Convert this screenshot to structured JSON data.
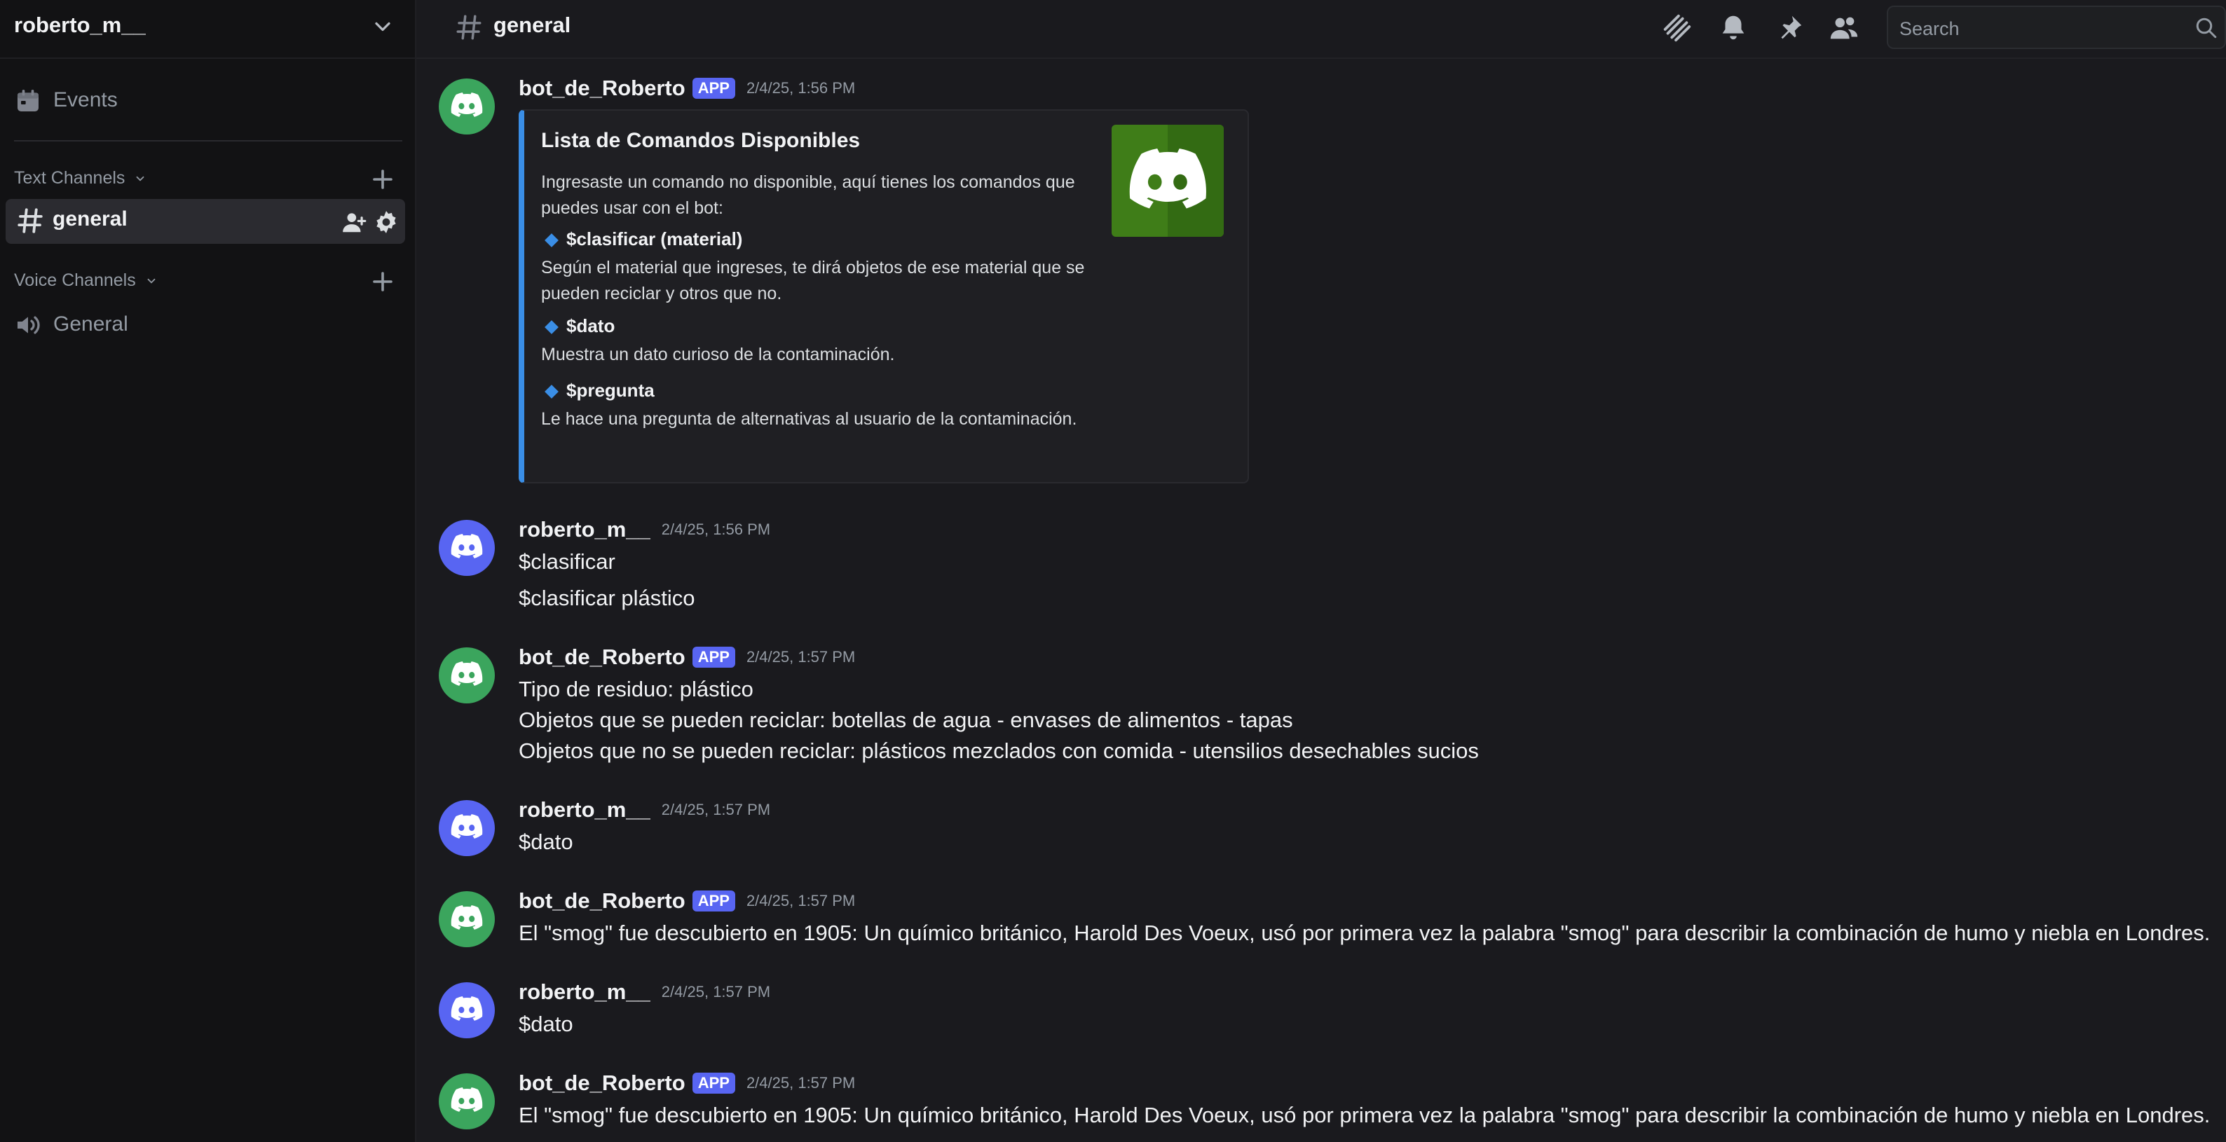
{
  "server": {
    "name": "roberto_m__"
  },
  "sidebar": {
    "events_label": "Events",
    "text_category": "Text Channels",
    "voice_category": "Voice Channels",
    "active_channel": "general",
    "voice_channel": "General"
  },
  "topbar": {
    "channel": "general",
    "search_placeholder": "Search"
  },
  "messages": [
    {
      "author": "bot_de_Roberto",
      "badge": "APP",
      "timestamp": "2/4/25, 1:56 PM",
      "avatar_color": "#3ba55d",
      "embed": {
        "title": "Lista de Comandos Disponibles",
        "description": "Ingresaste un comando no disponible, aquí tienes los comandos que puedes usar con el bot:",
        "accent": "#3a8ee6",
        "fields": [
          {
            "name": "$clasificar (material)",
            "value": "Según el material que ingreses, te dirá objetos de ese material que se pueden reciclar y otros que no."
          },
          {
            "name": "$dato",
            "value": "Muestra un dato curioso de la contaminación."
          },
          {
            "name": "$pregunta",
            "value": "Le hace una pregunta de alternativas al usuario de la contaminación."
          }
        ]
      }
    },
    {
      "author": "roberto_m__",
      "timestamp": "2/4/25, 1:56 PM",
      "avatar_color": "#5865f2",
      "lines": [
        "$clasificar",
        "$clasificar plástico"
      ]
    },
    {
      "author": "bot_de_Roberto",
      "badge": "APP",
      "timestamp": "2/4/25, 1:57 PM",
      "avatar_color": "#3ba55d",
      "lines": [
        "Tipo de residuo: plástico",
        "Objetos que se pueden reciclar: botellas de agua - envases de alimentos - tapas",
        "Objetos que no se pueden reciclar: plásticos mezclados con comida - utensilios desechables sucios"
      ]
    },
    {
      "author": "roberto_m__",
      "timestamp": "2/4/25, 1:57 PM",
      "avatar_color": "#5865f2",
      "lines": [
        "$dato"
      ]
    },
    {
      "author": "bot_de_Roberto",
      "badge": "APP",
      "timestamp": "2/4/25, 1:57 PM",
      "avatar_color": "#3ba55d",
      "lines": [
        "El \"smog\" fue descubierto en 1905: Un químico británico, Harold Des Voeux, usó por primera vez la palabra \"smog\" para describir la combinación de humo y niebla en Londres."
      ]
    },
    {
      "author": "roberto_m__",
      "timestamp": "2/4/25, 1:57 PM",
      "avatar_color": "#5865f2",
      "lines": [
        "$dato"
      ]
    },
    {
      "author": "bot_de_Roberto",
      "badge": "APP",
      "timestamp": "2/4/25, 1:57 PM",
      "avatar_color": "#3ba55d",
      "lines": [
        "El \"smog\" fue descubierto en 1905: Un químico británico, Harold Des Voeux, usó por primera vez la palabra \"smog\" para describir la combinación de humo y niebla en Londres."
      ]
    }
  ]
}
